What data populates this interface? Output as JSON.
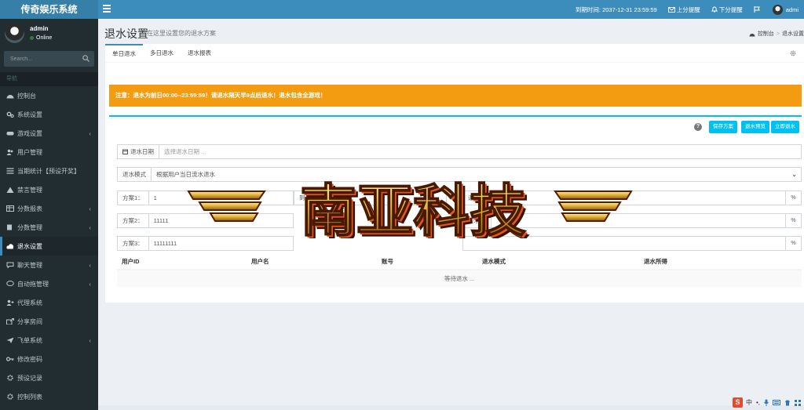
{
  "app": {
    "title": "传奇娱乐系统"
  },
  "topnav": {
    "expire": "到期时间: 2037-12-31 23:59:59",
    "upscore": "上分提醒",
    "downscore": "下分提醒",
    "user": "admi"
  },
  "user": {
    "name": "admin",
    "status": "Online"
  },
  "search": {
    "placeholder": "Search..."
  },
  "sidebar": {
    "header": "导航",
    "items": [
      {
        "label": "控制台",
        "icon": "dashboard-icon",
        "chevron": false
      },
      {
        "label": "系统设置",
        "icon": "cogs-icon",
        "chevron": false
      },
      {
        "label": "游戏设置",
        "icon": "gamepad-icon",
        "chevron": true
      },
      {
        "label": "用户管理",
        "icon": "users-icon",
        "chevron": false
      },
      {
        "label": "当期统计【预设开奖】",
        "icon": "list-icon",
        "chevron": false
      },
      {
        "label": "禁言管理",
        "icon": "warning-icon",
        "chevron": false
      },
      {
        "label": "分数报表",
        "icon": "table-icon",
        "chevron": true
      },
      {
        "label": "分数管理",
        "icon": "files-icon",
        "chevron": true
      },
      {
        "label": "退水设置",
        "icon": "cloud-icon",
        "chevron": false,
        "active": true
      },
      {
        "label": "聊天管理",
        "icon": "comments-icon",
        "chevron": true
      },
      {
        "label": "自动拖管理",
        "icon": "comment-icon",
        "chevron": true
      },
      {
        "label": "代理系统",
        "icon": "user-plus-icon",
        "chevron": false
      },
      {
        "label": "分享房间",
        "icon": "share-icon",
        "chevron": false
      },
      {
        "label": "飞单系统",
        "icon": "plane-icon",
        "chevron": true
      },
      {
        "label": "修改密码",
        "icon": "key-icon",
        "chevron": false
      },
      {
        "label": "预设记录",
        "icon": "cog-icon",
        "chevron": false
      },
      {
        "label": "控制列表",
        "icon": "cog-icon",
        "chevron": false
      }
    ]
  },
  "page": {
    "title": "退水设置",
    "subtitle": "在这里设置您的退水方案",
    "breadcrumb": [
      "控制台",
      "退水设置"
    ]
  },
  "tabs": [
    "单日退水",
    "多日退水",
    "退水报表"
  ],
  "alert": "注意：退水为前日00:00--23:59:59！请退水隔天早9点后退水！退水包含全游戏！",
  "buttons": {
    "save": "保存方案",
    "preview": "退水预览",
    "now": "立即退水"
  },
  "form": {
    "date_label": "退水日期",
    "date_placeholder": "选择退水日期 ...",
    "mode_label": "退水模式",
    "mode_value": "根据用户当日流水退水",
    "plans": [
      {
        "label": "方案1：",
        "from": "1",
        "to_label": "到",
        "to": "1111",
        "pct_label": "退水百分比",
        "pct": "1",
        "unit": "%"
      },
      {
        "label": "方案2：",
        "from": "11111",
        "to_label": "",
        "to": "",
        "pct_label": "退水百",
        "pct": "",
        "unit": "%"
      },
      {
        "label": "方案3：",
        "from": "11111111",
        "to_label": "",
        "to": "",
        "pct_label": "",
        "pct": "",
        "unit": "%"
      }
    ]
  },
  "table": {
    "columns": [
      "用户ID",
      "用户名",
      "账号",
      "退水模式",
      "退水所得"
    ],
    "empty": "等待退水 ..."
  },
  "watermark": "南亚科技",
  "ime": {
    "logo": "S",
    "lang": "中",
    "punct": "•,"
  }
}
